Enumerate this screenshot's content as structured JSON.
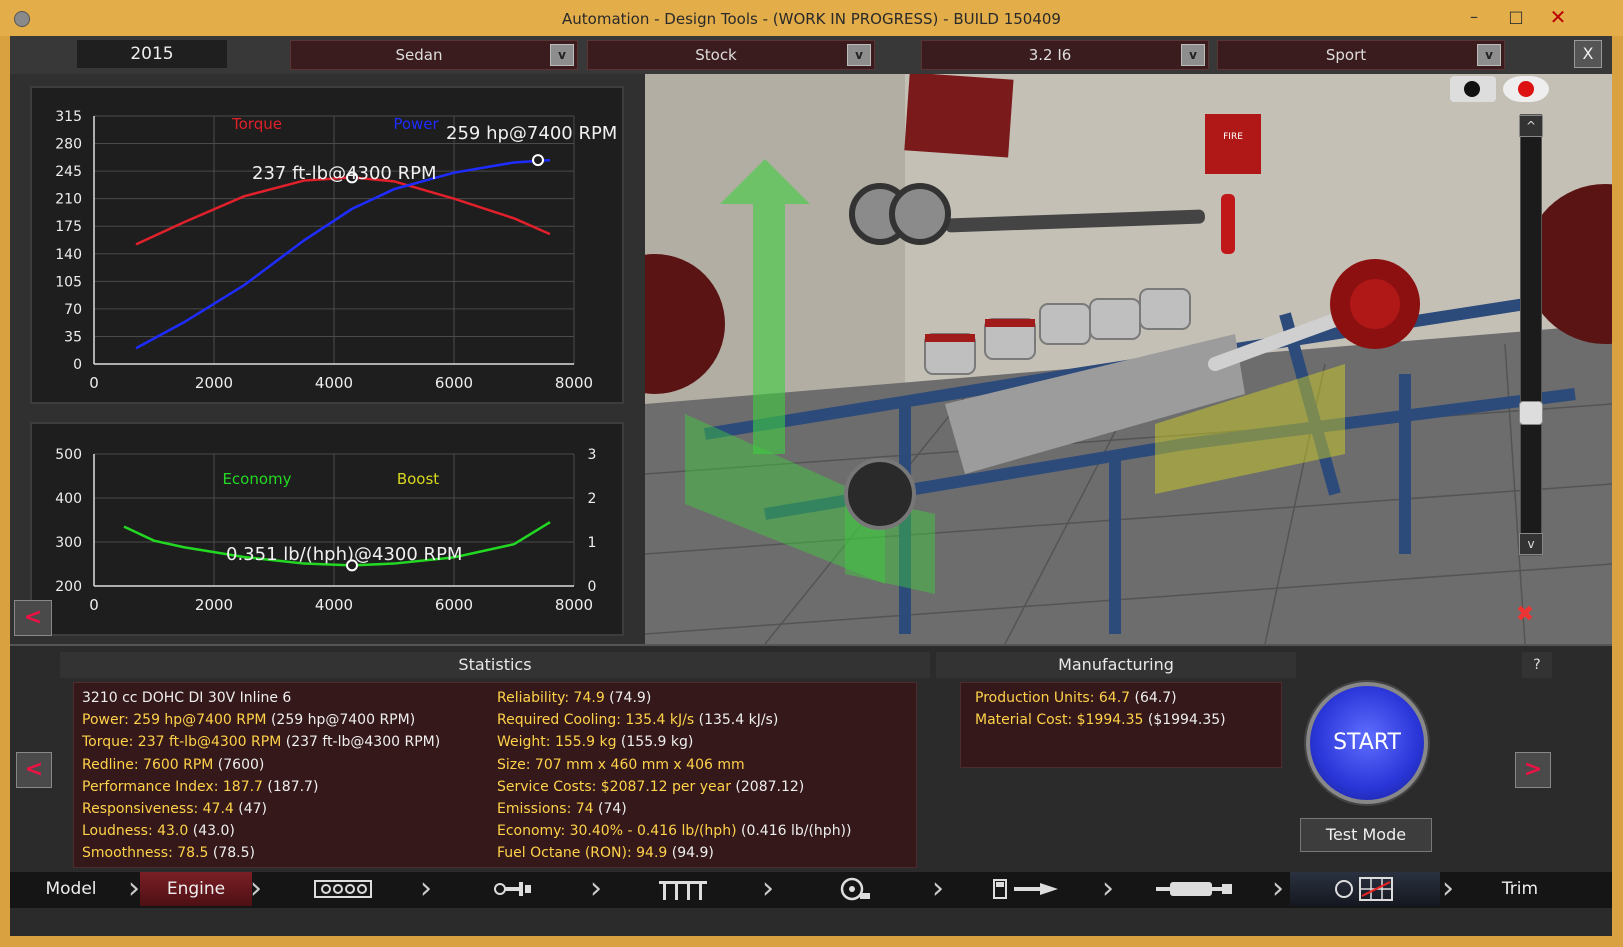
{
  "window": {
    "title": "Automation - Design Tools - (WORK IN PROGRESS) - BUILD 150409",
    "minimize": "–",
    "maximize": "□",
    "close": "✕"
  },
  "topbar": {
    "year": "2015",
    "body": "Sedan",
    "variant": "Stock",
    "engine": "3.2 I6",
    "trim": "Sport",
    "dropdown_glyph": "v",
    "close_glyph": "X"
  },
  "power_graph": {
    "torque_label": "Torque",
    "power_label": "Power",
    "power_peak": "259 hp@7400 RPM",
    "torque_peak": "237 ft-lb@4300 RPM",
    "y_ticks": [
      "315",
      "280",
      "245",
      "210",
      "175",
      "140",
      "105",
      "70",
      "35",
      "0"
    ],
    "x_ticks": [
      "0",
      "2000",
      "4000",
      "6000",
      "8000"
    ],
    "torque_color": "#e0202a",
    "power_color": "#1f2cff"
  },
  "economy_graph": {
    "economy_label": "Economy",
    "boost_label": "Boost",
    "economy_peak": "0.351 lb/(hph)@4300 RPM",
    "y_ticks": [
      "500",
      "400",
      "300",
      "200"
    ],
    "y2_ticks": [
      "3",
      "2",
      "1",
      "0"
    ],
    "x_ticks": [
      "0",
      "2000",
      "4000",
      "6000",
      "8000"
    ],
    "economy_color": "#22d822",
    "boost_color": "#d8d820"
  },
  "chart_data": [
    {
      "type": "line",
      "xlim": [
        0,
        8000
      ],
      "ylim": [
        0,
        315
      ],
      "series": [
        {
          "name": "Torque",
          "x": [
            700,
            1500,
            2500,
            3500,
            4300,
            5000,
            6000,
            7000,
            7600
          ],
          "values": [
            152,
            180,
            213,
            233,
            237,
            232,
            210,
            185,
            165
          ]
        },
        {
          "name": "Power",
          "x": [
            700,
            1500,
            2500,
            3500,
            4300,
            5000,
            6000,
            7000,
            7600
          ],
          "values": [
            20,
            53,
            100,
            157,
            197,
            222,
            243,
            256,
            259
          ]
        }
      ]
    },
    {
      "type": "line",
      "xlim": [
        0,
        8000
      ],
      "ylim": [
        200,
        500
      ],
      "series": [
        {
          "name": "Economy",
          "x": [
            500,
            1000,
            1500,
            2500,
            3500,
            4300,
            5000,
            6000,
            7000,
            7600
          ],
          "values": [
            335,
            303,
            288,
            266,
            251,
            247,
            251,
            265,
            295,
            345
          ]
        }
      ]
    }
  ],
  "statistics": {
    "header": "Statistics",
    "engine_desc": "3210 cc DOHC DI 30V Inline 6",
    "left": [
      {
        "k": "Power: 259 hp@7400 RPM",
        "v": "(259 hp@7400 RPM)"
      },
      {
        "k": "Torque: 237 ft-lb@4300 RPM",
        "v": "(237 ft-lb@4300 RPM)"
      },
      {
        "k": "Redline: 7600 RPM",
        "v": "(7600)"
      },
      {
        "k": "Performance Index: 187.7",
        "v": "(187.7)"
      },
      {
        "k": "Responsiveness: 47.4",
        "v": "(47)"
      },
      {
        "k": "Loudness: 43.0",
        "v": "(43.0)"
      },
      {
        "k": "Smoothness: 78.5",
        "v": "(78.5)"
      }
    ],
    "right": [
      {
        "k": "Reliability: 74.9",
        "v": "(74.9)"
      },
      {
        "k": "Required Cooling: 135.4 kJ/s",
        "v": "(135.4 kJ/s)"
      },
      {
        "k": "Weight: 155.9 kg",
        "v": "(155.9 kg)"
      },
      {
        "k": "Size: 707 mm x 460 mm x 406 mm",
        "v": ""
      },
      {
        "k": "Service Costs: $2087.12 per year",
        "v": "(2087.12)"
      },
      {
        "k": "Emissions: 74",
        "v": "(74)"
      },
      {
        "k": "Economy: 30.40% - 0.416 lb/(hph)",
        "v": "(0.416 lb/(hph))"
      },
      {
        "k": "Fuel Octane (RON): 94.9",
        "v": "(94.9)"
      }
    ]
  },
  "manufacturing": {
    "header": "Manufacturing",
    "rows": [
      {
        "k": "Production Units: 64.7",
        "v": "(64.7)"
      },
      {
        "k": "Material Cost: $1994.35",
        "v": "($1994.35)"
      }
    ]
  },
  "actions": {
    "start": "START",
    "test_mode": "Test Mode",
    "help": "?",
    "prev": "<",
    "next": ">"
  },
  "view3d": {
    "sign": "FIRE EXTINGUISHER",
    "scroll_up": "^",
    "scroll_down": "v"
  },
  "nav": {
    "model": "Model",
    "engine": "Engine",
    "trim": "Trim",
    "icons": [
      "block-icon",
      "head-icon",
      "valvetrain-icon",
      "turbo-icon",
      "fuel-icon",
      "exhaust-icon",
      "tuning-icon"
    ]
  }
}
